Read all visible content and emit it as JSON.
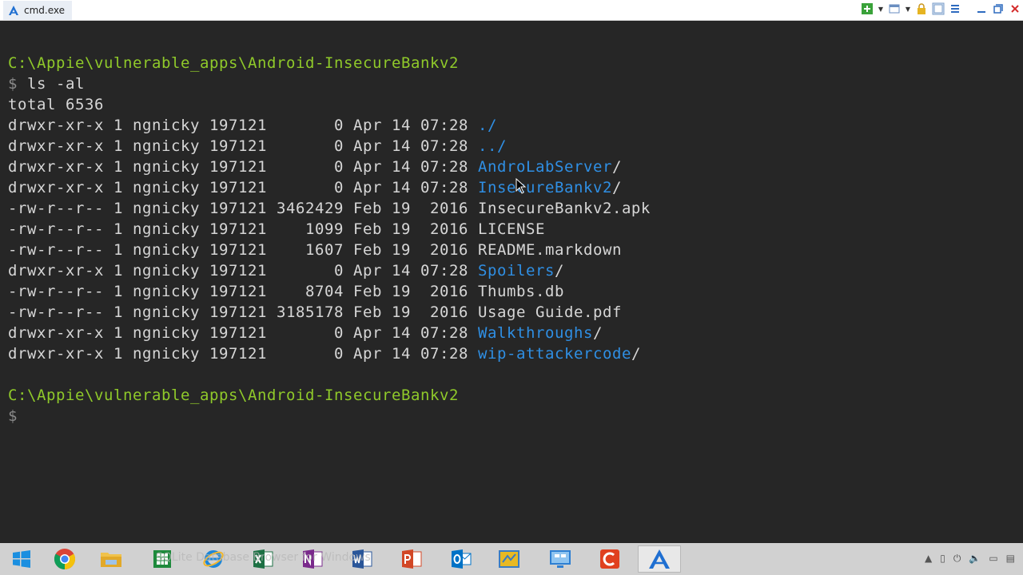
{
  "window": {
    "title": "cmd.exe",
    "tab_title": "cmd.exe"
  },
  "toolbar": {
    "icons": [
      "add-tab-icon",
      "dropdown-icon",
      "window-icon",
      "dropdown-icon",
      "lock-icon",
      "split-icon",
      "menu-icon",
      "minimize-icon",
      "maximize-icon",
      "close-icon"
    ]
  },
  "console": {
    "prompt_path": "C:\\Appie\\vulnerable_apps\\Android-InsecureBankv2",
    "prompt_symbol": "$",
    "command": " ls -al",
    "total_line": "total 6536",
    "entries": [
      {
        "meta": "drwxr-xr-x 1 ngnicky 197121       0 Apr 14 07:28 ",
        "name": "./",
        "type": "dots",
        "suffix": ""
      },
      {
        "meta": "drwxr-xr-x 1 ngnicky 197121       0 Apr 14 07:28 ",
        "name": "../",
        "type": "dots",
        "suffix": ""
      },
      {
        "meta": "drwxr-xr-x 1 ngnicky 197121       0 Apr 14 07:28 ",
        "name": "AndroLabServer",
        "type": "dir",
        "suffix": "/"
      },
      {
        "meta": "drwxr-xr-x 1 ngnicky 197121       0 Apr 14 07:28 ",
        "name": "InsecureBankv2",
        "type": "dir",
        "suffix": "/"
      },
      {
        "meta": "-rw-r--r-- 1 ngnicky 197121 3462429 Feb 19  2016 ",
        "name": "InsecureBankv2.apk",
        "type": "file",
        "suffix": ""
      },
      {
        "meta": "-rw-r--r-- 1 ngnicky 197121    1099 Feb 19  2016 ",
        "name": "LICENSE",
        "type": "file",
        "suffix": ""
      },
      {
        "meta": "-rw-r--r-- 1 ngnicky 197121    1607 Feb 19  2016 ",
        "name": "README.markdown",
        "type": "file",
        "suffix": ""
      },
      {
        "meta": "drwxr-xr-x 1 ngnicky 197121       0 Apr 14 07:28 ",
        "name": "Spoilers",
        "type": "dir",
        "suffix": "/"
      },
      {
        "meta": "-rw-r--r-- 1 ngnicky 197121    8704 Feb 19  2016 ",
        "name": "Thumbs.db",
        "type": "file",
        "suffix": ""
      },
      {
        "meta": "-rw-r--r-- 1 ngnicky 197121 3185178 Feb 19  2016 ",
        "name": "Usage Guide.pdf",
        "type": "file",
        "suffix": ""
      },
      {
        "meta": "drwxr-xr-x 1 ngnicky 197121       0 Apr 14 07:28 ",
        "name": "Walkthroughs",
        "type": "dir",
        "suffix": "/"
      },
      {
        "meta": "drwxr-xr-x 1 ngnicky 197121       0 Apr 14 07:28 ",
        "name": "wip-attackercode",
        "type": "dir",
        "suffix": "/"
      }
    ]
  },
  "taskbar": {
    "ghost_text": "SQLite Database Browser for Windows",
    "apps": [
      {
        "name": "start-button",
        "icon": "windows-logo-icon"
      },
      {
        "name": "chrome-button",
        "icon": "chrome-icon"
      },
      {
        "name": "file-explorer-button",
        "icon": "folder-icon"
      },
      {
        "name": "sqlite-browser-button",
        "icon": "spreadsheet-icon"
      },
      {
        "name": "internet-explorer-button",
        "icon": "ie-icon"
      },
      {
        "name": "excel-button",
        "icon": "excel-icon"
      },
      {
        "name": "onenote-button",
        "icon": "onenote-icon"
      },
      {
        "name": "word-button",
        "icon": "word-icon"
      },
      {
        "name": "powerpoint-button",
        "icon": "powerpoint-icon"
      },
      {
        "name": "outlook-button",
        "icon": "outlook-icon"
      },
      {
        "name": "map-app-button",
        "icon": "map-icon"
      },
      {
        "name": "remote-desktop-button",
        "icon": "remote-desktop-icon"
      },
      {
        "name": "camtasia-button",
        "icon": "camtasia-icon"
      },
      {
        "name": "cmder-button",
        "icon": "cmder-icon"
      }
    ],
    "tray_icons": [
      "tray-expand-icon",
      "battery-icon",
      "power-icon",
      "volume-icon",
      "network-icon",
      "action-center-icon"
    ]
  },
  "colors": {
    "console_bg": "#262626",
    "prompt_green": "#8fc92a",
    "directory_blue": "#2f8fe4",
    "text": "#d6d6d6"
  }
}
